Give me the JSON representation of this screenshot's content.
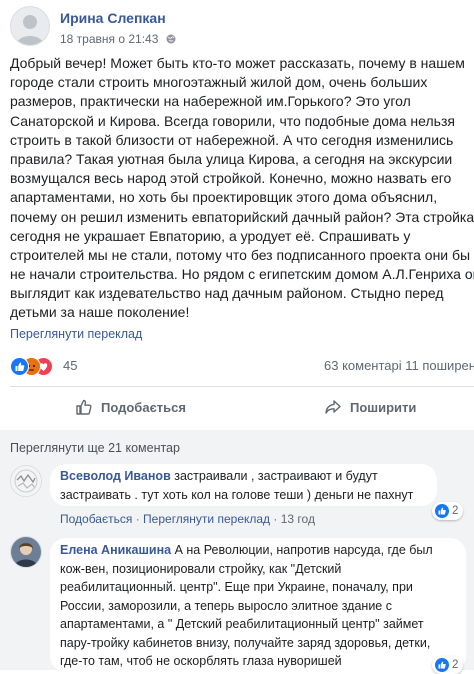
{
  "post": {
    "author": "Ирина Слепкан",
    "timestamp": "18 травня о 21:43",
    "text_lines": [
      "Добрый вечер! Может быть кто-то может рассказать, почему в нашем",
      "городе стали строить многоэтажный жилой дом, очень больших",
      "размеров, практически на набережной им.Горького? Это угол",
      "Санаторской и Кирова. Всегда говорили, что подобные дома нельзя",
      "строить в такой близости от набережной. А что сегодня изменились",
      "правила? Такая уютная была улица Кирова, а сегодня на экскурсии",
      "возмущался весь народ этой стройкой. Конечно, можно назвать его",
      "апартаментами, но хоть бы проектировщик этого дома объяснил,",
      "почему он решил изменить евпаторийский дачный район? Эта стройка",
      "сегодня не украшает Евпаторию, а уродует её. Спрашивать у",
      "строителей мы не стали, потому что без подписанного проекта они бы",
      "не начали строительства. Но рядом с египетским домом А.Л.Генриха он",
      "выглядит как издевательство над дачным районом. Стыдно перед",
      "детьми за наше поколение!"
    ],
    "see_translation": "Переглянути переклад",
    "reaction_count": "45",
    "comments_shares": "63 коментарі  11 поширен"
  },
  "actions": {
    "like": "Подобається",
    "share": "Поширити"
  },
  "comments_section": {
    "view_more": "Переглянути ще 21 коментар",
    "comments": [
      {
        "author": "Всеволод Иванов",
        "text_lines": [
          " застраивали , застраивают и будут",
          "застраивать . тут хоть кол на голове теши ) деньги не пахнут"
        ],
        "like_label": "Подобається",
        "translate_label": "Переглянути переклад",
        "time": "13 год",
        "reactions": "2"
      },
      {
        "author": "Елена Аникашина",
        "text_lines": [
          " А на Революции, напротив нарсуда, где был",
          "кож-вен, позиционировали стройку, как \"Детский",
          "реабилитационный. центр\". Еще при Украине, поначалу, при",
          "России, заморозили, а теперь выросло элитное здание с",
          "апартаментами, а \" Детский реабилитационный центр\" займет",
          "пару-тройку кабинетов внизу, получайте заряд здоровья, детки,",
          "где-то там, чтоб не оскорблять глаза нуворишей"
        ],
        "reactions": "2"
      }
    ]
  },
  "colors": {
    "link": "#385898",
    "like_blue": "#1877f2",
    "love_red": "#f33e58",
    "panel_bg": "#f2f3f5"
  }
}
